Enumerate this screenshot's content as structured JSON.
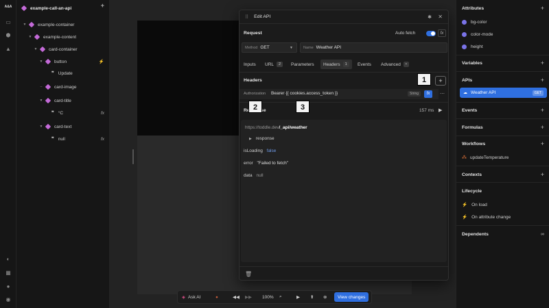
{
  "rail": {
    "logo": "A&A"
  },
  "tree": {
    "title": "example-call-an-api",
    "nodes": [
      {
        "label": "example-container"
      },
      {
        "label": "example-content"
      },
      {
        "label": "card-container"
      },
      {
        "label": "button"
      },
      {
        "label": "Update"
      },
      {
        "label": "card-image"
      },
      {
        "label": "card-title"
      },
      {
        "label": "°C",
        "suffix": "fx"
      },
      {
        "label": "card-text"
      },
      {
        "label": "null",
        "suffix": "fx"
      }
    ]
  },
  "modal": {
    "title": "Edit API",
    "request_label": "Request",
    "auto_fetch_label": "Auto fetch",
    "fx_label": "fx",
    "method_label": "Method",
    "method_value": "GET",
    "name_label": "Name",
    "name_value": "Weather API",
    "tabs": [
      {
        "label": "Inputs"
      },
      {
        "label": "URL",
        "badge": "2"
      },
      {
        "label": "Parameters"
      },
      {
        "label": "Headers",
        "badge": "1"
      },
      {
        "label": "Events"
      },
      {
        "label": "Advanced",
        "badge": "•"
      }
    ],
    "headers_label": "Headers",
    "header_key": "Authorization",
    "header_value": "Bearer {{ cookies.access_token }}",
    "header_type": "String",
    "response_label": "Response",
    "response_time": "157 ms",
    "url_prefix": "https://toddle.dev",
    "url_path": "/_api/weather",
    "response_node": "response",
    "isloading_key": "isLoading",
    "isloading_value": "false",
    "error_key": "error",
    "error_value": "\"Failed to fetch\"",
    "data_key": "data",
    "data_value": "null"
  },
  "callouts": [
    "1",
    "2",
    "3"
  ],
  "rpanel": {
    "attributes_label": "Attributes",
    "attributes": [
      "bg-color",
      "color-mode",
      "height"
    ],
    "variables_label": "Variables",
    "apis_label": "APIs",
    "api_item": "Weather API",
    "api_method": "GET",
    "events_label": "Events",
    "formulas_label": "Formulas",
    "workflows_label": "Workflows",
    "workflow_item": "updateTemperature",
    "contexts_label": "Contexts",
    "lifecycle_label": "Lifecycle",
    "on_load": "On load",
    "on_attr_change": "On attribute change",
    "dependents_label": "Dependents"
  },
  "bottom": {
    "ask_ai": "Ask AI",
    "zoom": "100%",
    "view_changes": "View changes"
  },
  "colors": {
    "accent": "#2f6fe0",
    "component": "#c46ad8",
    "attribute": "#7a73e8",
    "workflow": "#e8763a"
  }
}
